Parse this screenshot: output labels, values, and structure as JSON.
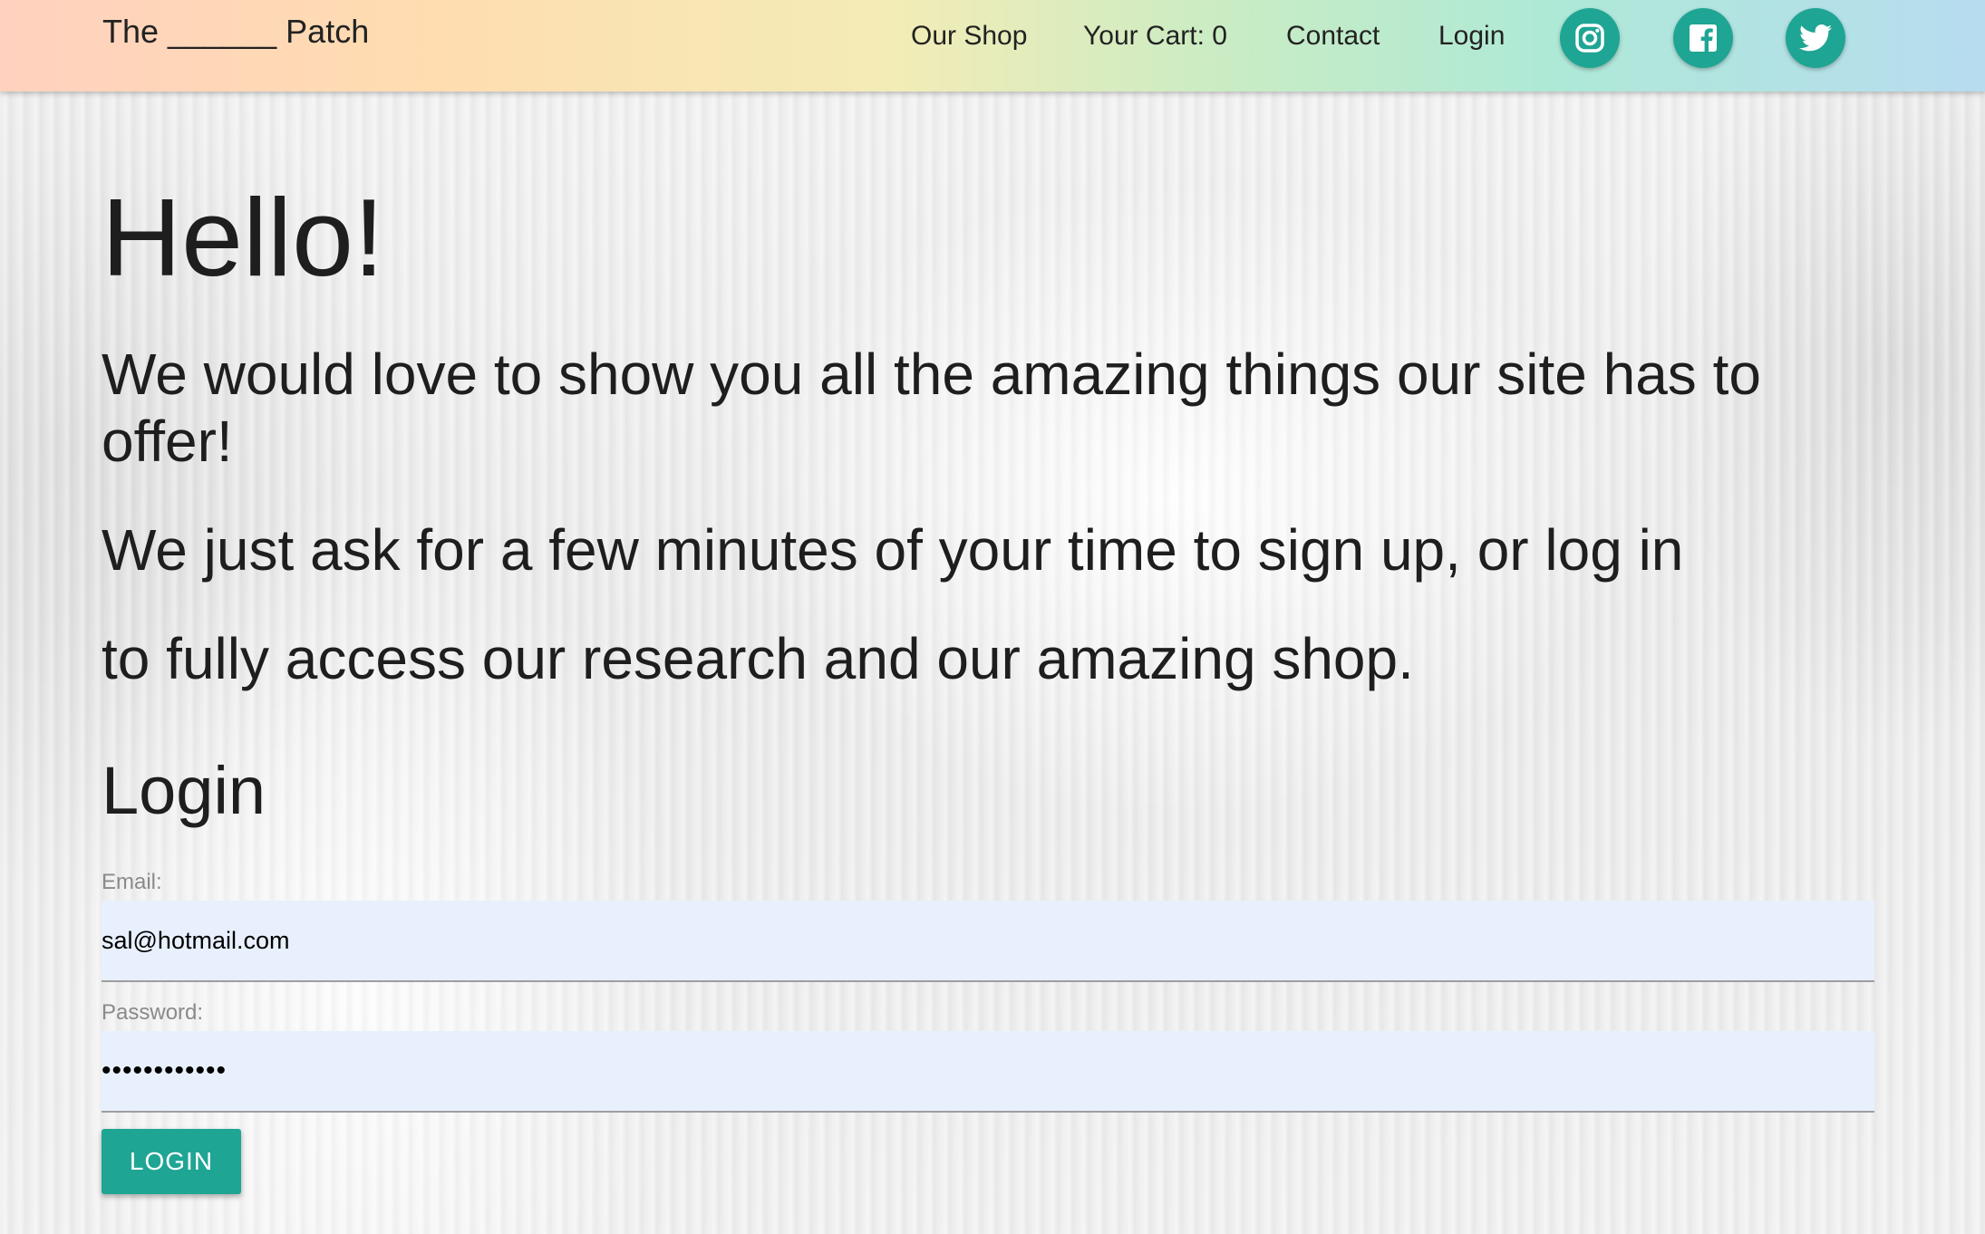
{
  "header": {
    "brand": "The ______ Patch",
    "nav": {
      "shop": "Our Shop",
      "cart": "Your Cart: 0",
      "contact": "Contact",
      "login": "Login"
    },
    "social": [
      "instagram-icon",
      "facebook-icon",
      "twitter-icon"
    ],
    "accent_color": "#1fa594"
  },
  "main": {
    "greeting": "Hello!",
    "intro_1": "We would love to show you all the amazing things our site has to offer!",
    "intro_2": "We just ask for a few minutes of your time to sign up, or log in",
    "intro_3": "to fully access our research and our amazing shop.",
    "login_title": "Login"
  },
  "form": {
    "email_label": "Email:",
    "email_value": "sal@hotmail.com",
    "password_label": "Password:",
    "password_value": "••••••••••••",
    "submit_label": "LOGIN",
    "field_color": "#e8f0fe"
  }
}
